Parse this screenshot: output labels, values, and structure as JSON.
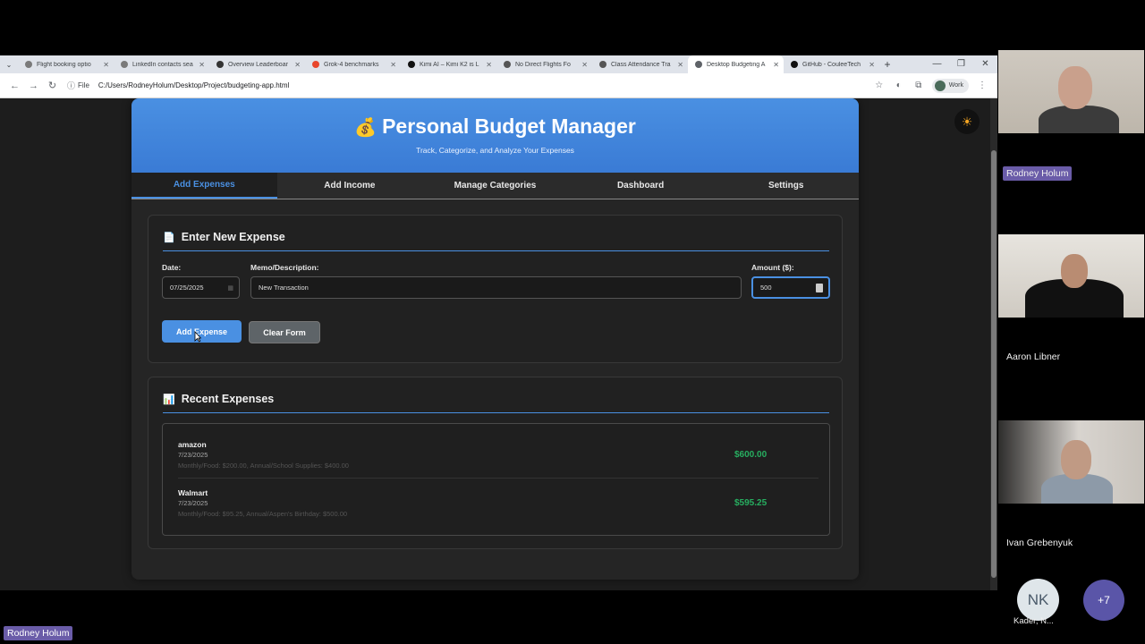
{
  "browser": {
    "tabs": [
      {
        "label": "Flight booking optio",
        "color": "#7a7a7a"
      },
      {
        "label": "LinkedIn contacts sea",
        "color": "#7a7a7a"
      },
      {
        "label": "Overview Leaderboar",
        "color": "#333333"
      },
      {
        "label": "Grok-4 benchmarks",
        "color": "#e8462b"
      },
      {
        "label": "Kimi AI – Kimi K2 is L",
        "color": "#111111"
      },
      {
        "label": "No Direct Flights Fo",
        "color": "#555555"
      },
      {
        "label": "Class Attendance Tra",
        "color": "#555555"
      },
      {
        "label": "Desktop Budgeting A",
        "color": "#5f6368",
        "active": true
      },
      {
        "label": "GitHub - CouleeTech",
        "color": "#111111"
      }
    ],
    "close_glyph": "✕",
    "new_tab_glyph": "+",
    "tab_menu_glyph": "⌄",
    "window_controls": [
      "—",
      "❐",
      "✕"
    ],
    "nav": {
      "back": "←",
      "forward": "→",
      "reload": "↻"
    },
    "address": {
      "info_icon": "ⓘ",
      "file_tag": "File",
      "url": "C:/Users/RodneyHolum/Desktop/Project/budgeting-app.html"
    },
    "right_icons": {
      "star": "☆",
      "ext1": "◐",
      "ext2": "⧉"
    },
    "profile": {
      "label": "Work"
    },
    "menu_glyph": "⋮"
  },
  "app": {
    "theme_toggle_icon": "☀",
    "header": {
      "emoji": "💰",
      "title": "Personal Budget Manager",
      "subtitle": "Track, Categorize, and Analyze Your Expenses"
    },
    "tabs": [
      "Add Expenses",
      "Add Income",
      "Manage Categories",
      "Dashboard",
      "Settings"
    ],
    "active_tab": "Add Expenses",
    "entry": {
      "emoji": "📄",
      "title": "Enter New Expense",
      "date_label": "Date:",
      "date_value": "07/25/2025",
      "memo_label": "Memo/Description:",
      "memo_value": "New Transaction",
      "amount_label": "Amount ($):",
      "amount_value": "500",
      "add_button": "Add Expense",
      "clear_button": "Clear Form"
    },
    "recent": {
      "emoji": "📊",
      "title": "Recent Expenses",
      "items": [
        {
          "name": "amazon",
          "date": "7/23/2025",
          "detail": "Monthly/Food: $200.00, Annual/School Supplies: $400.00",
          "amount": "$600.00"
        },
        {
          "name": "Walmart",
          "date": "7/23/2025",
          "detail": "Monthly/Food: $95.25, Annual/Aspen's Birthday: $500.00",
          "amount": "$595.25"
        }
      ]
    },
    "accent_color": "#4a90e2",
    "amount_color": "#27ae60"
  },
  "meeting": {
    "participants": [
      {
        "name": "Rodney Holum"
      },
      {
        "name": "Aaron Libner"
      },
      {
        "name": "Ivan Grebenyuk"
      }
    ],
    "extra_initials": "NK",
    "extra_name": "Kader, N...",
    "more_count": "+7",
    "presenter_label": "Rodney Holum"
  }
}
